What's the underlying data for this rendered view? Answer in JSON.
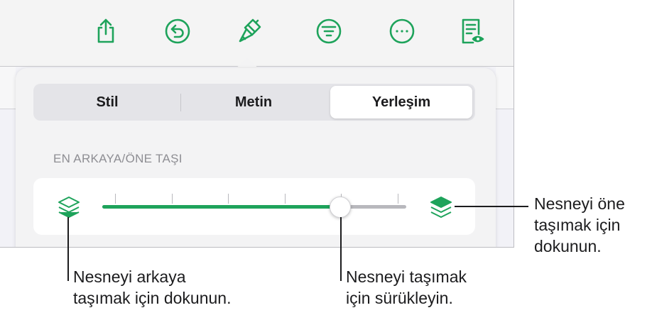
{
  "tabs": [
    {
      "label": "Stil",
      "selected": false
    },
    {
      "label": "Metin",
      "selected": false
    },
    {
      "label": "Yerleşim",
      "selected": true
    }
  ],
  "section_title": "EN ARKAYA/ÖNE TAŞI",
  "slider": {
    "value_fraction": 0.78,
    "tick_count": 6
  },
  "callouts": {
    "front": [
      "Nesneyi öne",
      "taşımak için",
      "dokunun."
    ],
    "back": [
      "Nesneyi arkaya",
      "taşımak için dokunun."
    ],
    "drag": [
      "Nesneyi taşımak",
      "için sürükleyin."
    ]
  },
  "toolbar_icons": [
    "share-icon",
    "undo-icon",
    "format-brush-icon",
    "filter-icon",
    "more-icon",
    "document-view-icon"
  ],
  "colors": {
    "accent": "#1ea35b",
    "text": "#1c1c1e",
    "muted": "#8e8e93"
  }
}
